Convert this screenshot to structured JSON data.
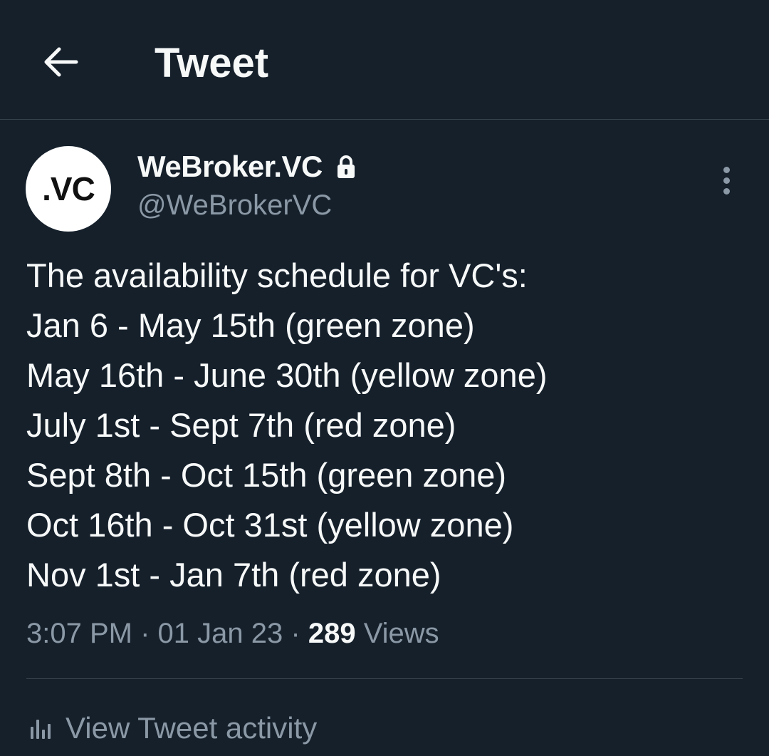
{
  "header": {
    "back_icon": "arrow-left-icon",
    "title": "Tweet"
  },
  "author": {
    "avatar_text": ".VC",
    "display_name": "WeBroker.VC",
    "protected_icon": "lock-icon",
    "handle": "@WeBrokerVC"
  },
  "more_icon": "more-vertical-icon",
  "tweet": {
    "lines": [
      "The availability schedule for VC's:",
      "Jan 6 - May 15th (green zone)",
      "May 16th - June 30th (yellow zone)",
      "July 1st - Sept 7th (red zone)",
      "Sept 8th - Oct 15th (green zone)",
      "Oct 16th - Oct 31st (yellow zone)",
      "Nov 1st - Jan 7th (red zone)"
    ]
  },
  "meta": {
    "time": "3:07 PM",
    "separator": "·",
    "date": "01 Jan 23",
    "views_count": "289",
    "views_label": "Views"
  },
  "activity": {
    "icon": "analytics-icon",
    "label": "View Tweet activity"
  },
  "colors": {
    "background": "#15202b",
    "text_primary": "#f7f9f9",
    "text_secondary": "#8b98a5",
    "border": "#38444d"
  }
}
